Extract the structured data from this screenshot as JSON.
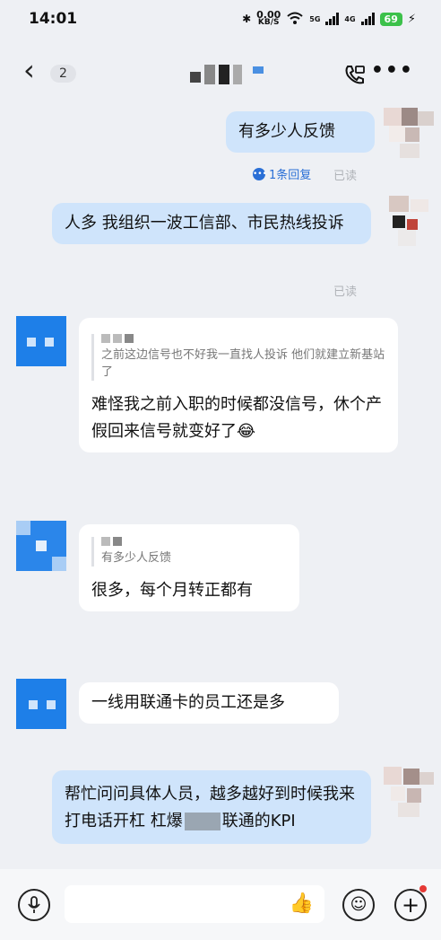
{
  "status": {
    "time": "14:01",
    "speed_value": "0.00",
    "speed_unit": "KB/S",
    "net1": "5G",
    "net2": "4G",
    "battery": "69"
  },
  "header": {
    "unread_count": "2"
  },
  "messages": {
    "m1": {
      "text": "有多少人反馈",
      "reply_count": "1条回复",
      "read": "已读"
    },
    "m2": {
      "text": "人多 我组织一波工信部、市民热线投诉",
      "read": "已读"
    },
    "m3": {
      "quote": "之前这边信号也不好我一直找人投诉 他们就建立新基站了",
      "text": "难怪我之前入职的时候都没信号，休个产假回来信号就变好了😂"
    },
    "m4": {
      "quote": "有多少人反馈",
      "text": "很多，每个月转正都有"
    },
    "m5": {
      "text": "一线用联通卡的员工还是多"
    },
    "m6": {
      "text_a": "帮忙问问具体人员，越多越好到时候我来打电话开杠 杠爆",
      "text_b": "联通的KPI"
    }
  },
  "icons": {
    "back": "back-arrow-icon",
    "call": "voice-video-call-icon",
    "more": "more-icon",
    "voice": "microphone-icon",
    "emoji": "emoji-icon",
    "plus": "plus-icon",
    "like": "thumbs-up-icon"
  },
  "colors": {
    "my_bubble": "#cfe4fb",
    "their_bubble": "#ffffff",
    "link": "#2a6fd6",
    "battery": "#3cc14a"
  }
}
